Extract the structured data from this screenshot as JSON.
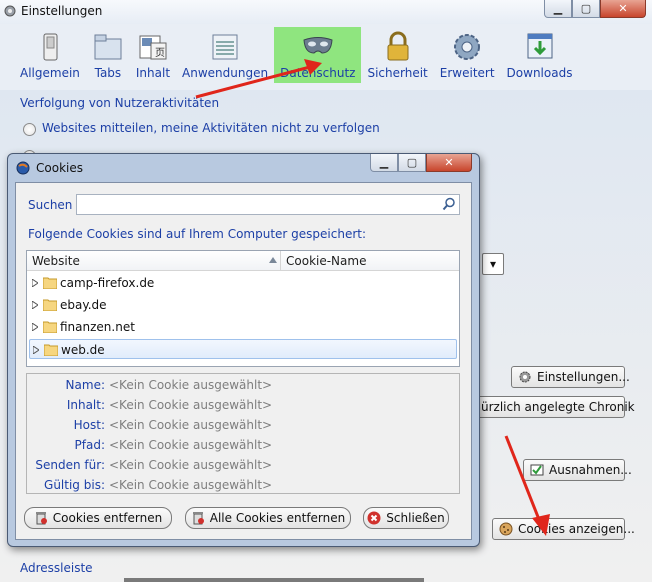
{
  "main": {
    "title": "Einstellungen",
    "toolbar": [
      {
        "label": "Allgemein",
        "icon": "switch-icon"
      },
      {
        "label": "Tabs",
        "icon": "tabs-folder-icon"
      },
      {
        "label": "Inhalt",
        "icon": "content-icon"
      },
      {
        "label": "Anwendungen",
        "icon": "applications-icon"
      },
      {
        "label": "Datenschutz",
        "icon": "privacy-mask-icon",
        "active": true
      },
      {
        "label": "Sicherheit",
        "icon": "padlock-icon"
      },
      {
        "label": "Erweitert",
        "icon": "gear-icon"
      },
      {
        "label": "Downloads",
        "icon": "download-icon"
      }
    ],
    "section_title": "Verfolgung von Nutzeraktivitäten",
    "option1": "Websites mitteilen, meine Aktivitäten nicht zu verfolgen",
    "settings_button": "Einstellungen...",
    "history_button": "ürzlich angelegte Chronik",
    "exceptions_button": "Ausnahmen...",
    "show_cookies_button": "Cookies anzeigen...",
    "address_bar_label": "Adressleiste"
  },
  "dialog": {
    "title": "Cookies",
    "search_label": "Suchen",
    "search_value": "",
    "list_caption": "Folgende Cookies sind auf Ihrem Computer gespeichert:",
    "columns": [
      "Website",
      "Cookie-Name"
    ],
    "rows": [
      "camp-firefox.de",
      "ebay.de",
      "finanzen.net",
      "web.de"
    ],
    "selected_row": "web.de",
    "details": [
      {
        "key": "Name:",
        "value": "<Kein Cookie ausgewählt>"
      },
      {
        "key": "Inhalt:",
        "value": "<Kein Cookie ausgewählt>"
      },
      {
        "key": "Host:",
        "value": "<Kein Cookie ausgewählt>"
      },
      {
        "key": "Pfad:",
        "value": "<Kein Cookie ausgewählt>"
      },
      {
        "key": "Senden für:",
        "value": "<Kein Cookie ausgewählt>"
      },
      {
        "key": "Gültig bis:",
        "value": "<Kein Cookie ausgewählt>"
      }
    ],
    "remove_button": "Cookies entfernen",
    "remove_all_button": "Alle Cookies entfernen",
    "close_button": "Schließen"
  },
  "colors": {
    "link_blue": "#1c3fa6",
    "active_tab": "#8fe57f",
    "annotation_arrow": "#e0261b"
  }
}
